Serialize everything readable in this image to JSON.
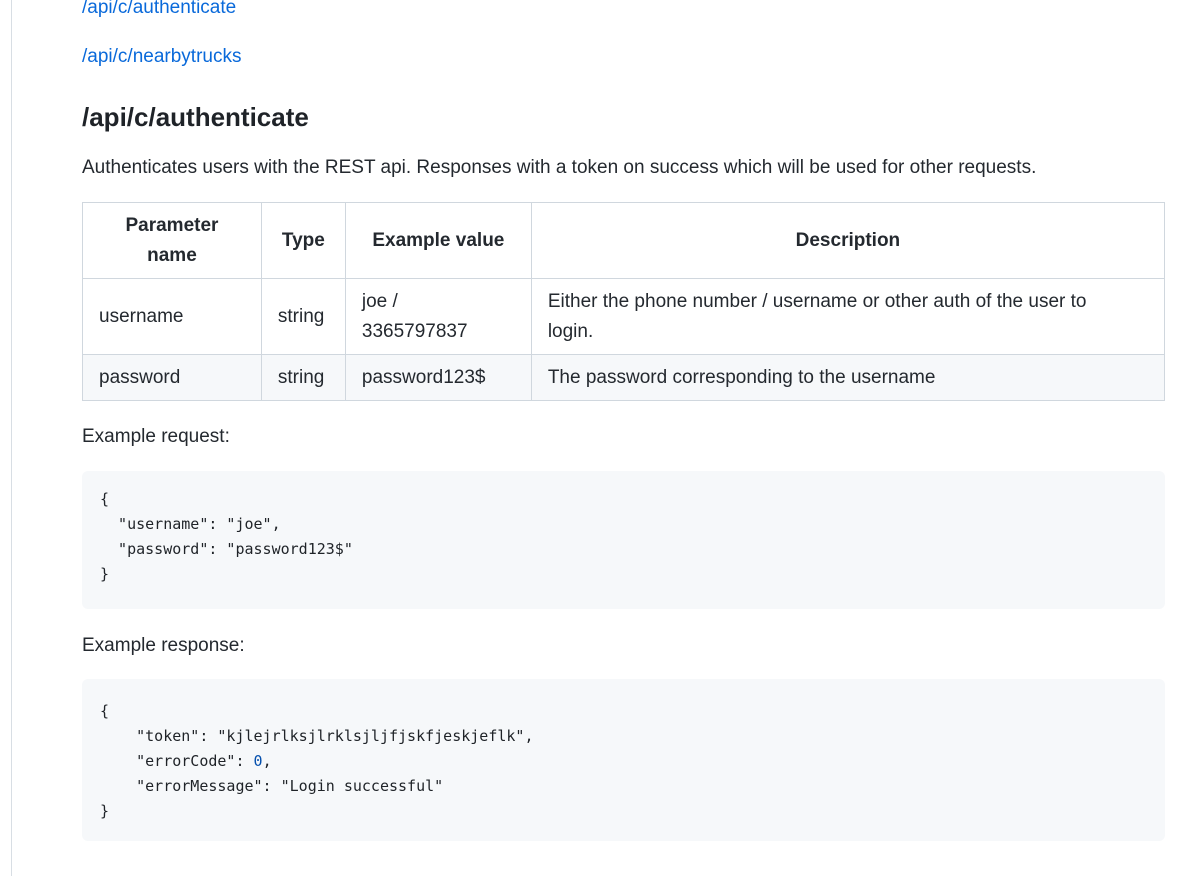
{
  "toc": {
    "links": [
      "/api/c/authenticate",
      "/api/c/nearbytrucks"
    ]
  },
  "section": {
    "title": "/api/c/authenticate",
    "description": "Authenticates users with the REST api. Responses with a token on success which will be used for other requests."
  },
  "table": {
    "headers": {
      "param_line1": "Parameter",
      "param_line2": "name",
      "type": "Type",
      "example": "Example value",
      "description": "Description"
    },
    "rows": [
      {
        "name": "username",
        "type": "string",
        "example_line1": "joe /",
        "example_line2": "3365797837",
        "desc_line1": "Either the phone number / username or other auth of the user to",
        "desc_line2": "login."
      },
      {
        "name": "password",
        "type": "string",
        "example": "password123$",
        "desc": "The password corresponding to the username"
      }
    ]
  },
  "request": {
    "label": "Example request:",
    "open": "{",
    "line1": "  \"username\": \"joe\",",
    "line2": "  \"password\": \"password123$\"",
    "close": "}"
  },
  "response": {
    "label": "Example response:",
    "open": "{",
    "line1_pre": "    \"token\": \"kjlejrlksjlrklsjljfjskfjeskjeflk\",",
    "line2_pre": "    \"errorCode\": ",
    "line2_num": "0",
    "line2_post": ",",
    "line3": "    \"errorMessage\": \"Login successful\"",
    "close": "}"
  }
}
